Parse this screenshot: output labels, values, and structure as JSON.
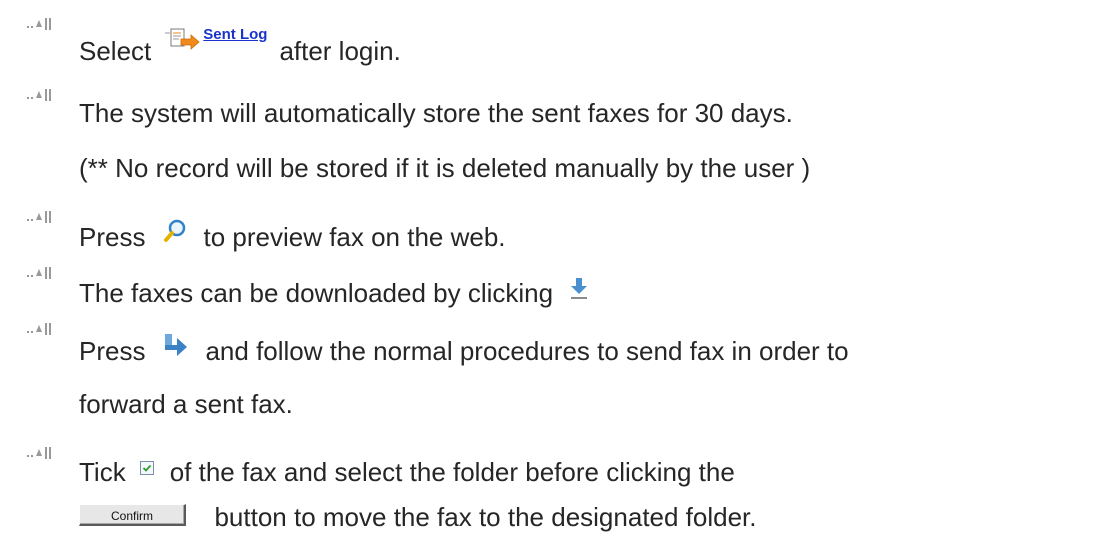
{
  "instructions": {
    "item1": {
      "before": "Select",
      "link_label": "Sent Log",
      "after": "after login."
    },
    "item2": {
      "line1": "The system will automatically store the sent faxes for 30 days.",
      "line2": "(** No record will be stored if it is deleted manually by the user )"
    },
    "item3": {
      "before": "Press",
      "after": "to preview fax on the web."
    },
    "item4": {
      "text": "The faxes can be downloaded by clicking"
    },
    "item5": {
      "before": "Press",
      "after": "and follow the normal procedures to send fax in order to",
      "line2": "forward a sent fax."
    },
    "item6": {
      "before": "Tick",
      "after": "of the fax and select the folder before clicking the",
      "button_label": "Confirm",
      "line2": "button to move the fax to the designated folder."
    }
  },
  "icons": {
    "bullet": "arrow-bullet-icon",
    "sent_log": "document-arrow-icon",
    "preview": "magnifier-icon",
    "download": "download-arrow-icon",
    "forward": "forward-arrow-icon",
    "checkbox": "checkbox-icon"
  },
  "colors": {
    "text": "#262626",
    "link": "#1a33cc",
    "orange_arrow": "#f08a1c",
    "blue_icon": "#4a8fd0"
  }
}
